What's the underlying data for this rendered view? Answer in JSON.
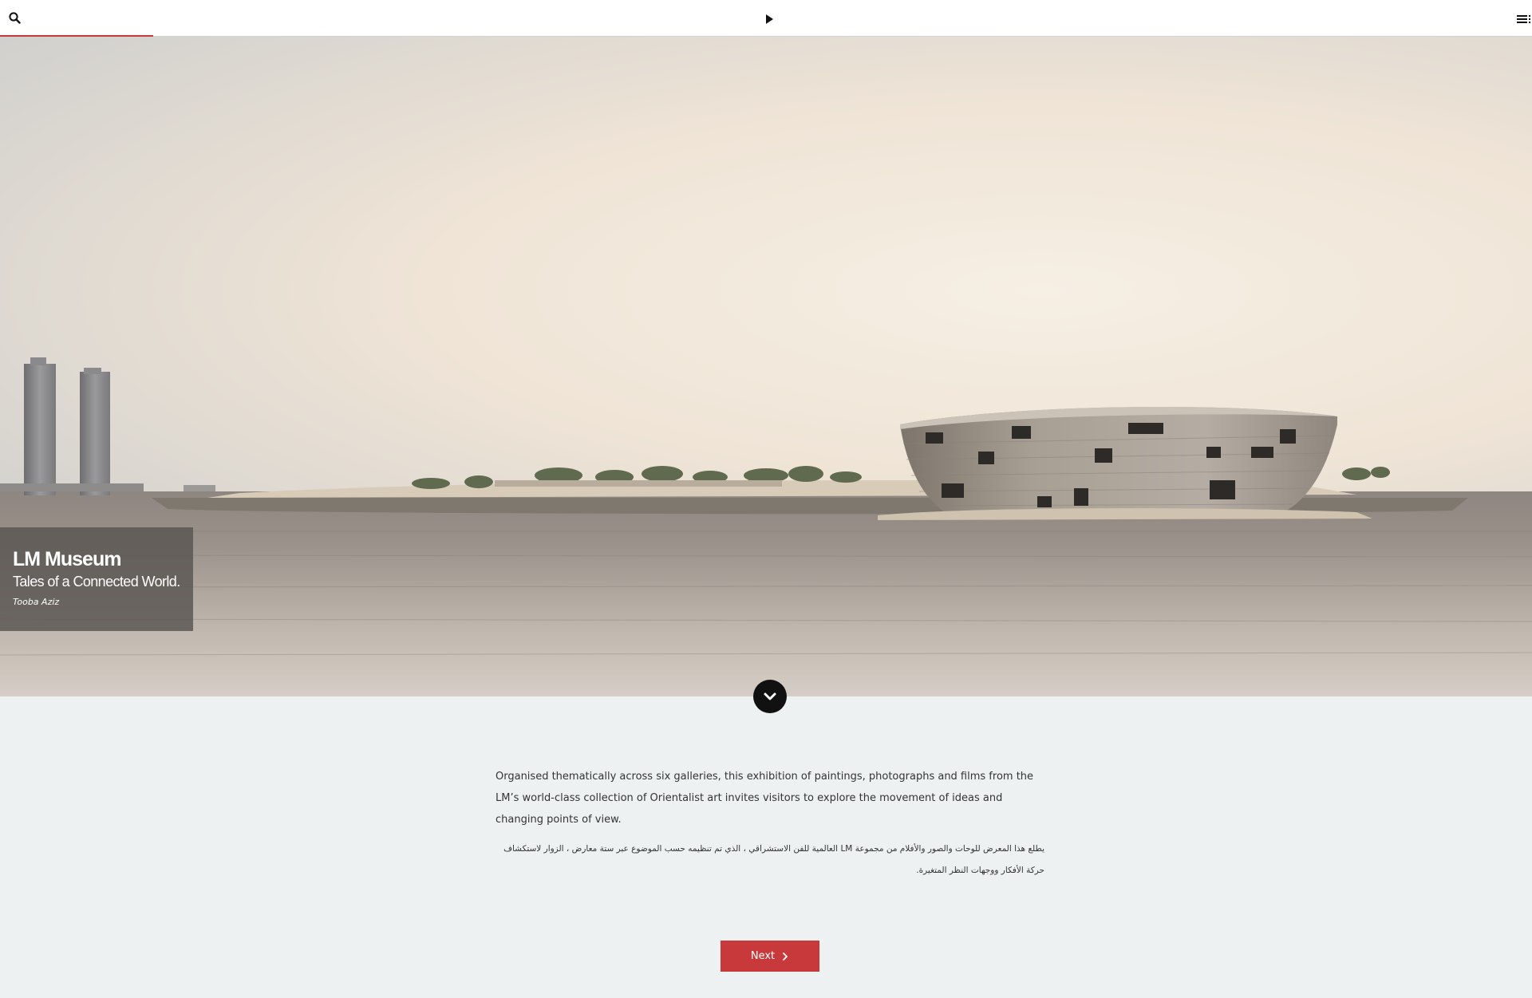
{
  "topbar": {
    "progress": 0.1,
    "search_icon": "search-icon",
    "play_icon": "play-icon",
    "menu_icon": "menu-icon"
  },
  "hero": {
    "title": "LM Museum",
    "subtitle": "Tales of a Connected World.",
    "author": "Tooba Aziz",
    "scroll_icon": "chevron-down-icon"
  },
  "intro": {
    "english": "Organised thematically across six galleries, this exhibition of paintings, photographs and films from the LM’s world-class collection of Orientalist art invites visitors to explore the movement of ideas and changing points of view.",
    "arabic": "يطلع هذا المعرض للوحات والصور والأفلام من مجموعة LM العالمية للفن الاستشراقي ، الذي تم تنظيمه حسب الموضوع عبر ستة معارض ، الزوار لاستكشاف حركة الأفكار ووجهات النظر المتغيرة."
  },
  "navigation": {
    "next_label": "Next",
    "next_icon": "chevron-right-icon"
  },
  "colors": {
    "accent": "#c8393b",
    "page_background": "#eef1f2",
    "caption_background": "#58544f"
  }
}
